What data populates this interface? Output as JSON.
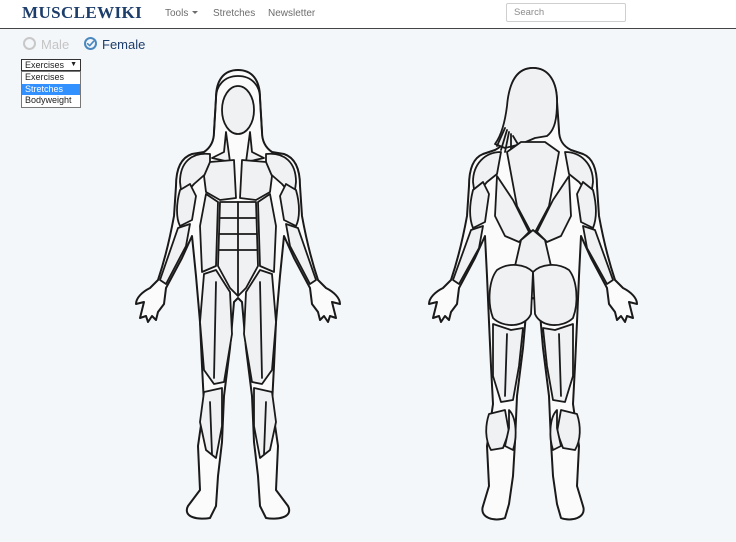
{
  "navbar": {
    "brand": "MUSCLEWIKI",
    "tools_label": "Tools",
    "stretches_label": "Stretches",
    "newsletter_label": "Newsletter",
    "search_placeholder": "Search",
    "brand_color": "#1d3d6b"
  },
  "gender": {
    "male_label": "Male",
    "female_label": "Female",
    "selected": "Female"
  },
  "category_select": {
    "current_value": "Exercises",
    "options": [
      "Exercises",
      "Stretches",
      "Bodyweight"
    ],
    "highlighted_option": "Stretches",
    "highlight_color": "#3390ff"
  },
  "icons": {
    "male_radio": "radio-unchecked-icon",
    "female_radio": "radio-checked-icon",
    "tools_caret": "caret-down-icon",
    "select_arrow": "triangle-down-icon"
  }
}
